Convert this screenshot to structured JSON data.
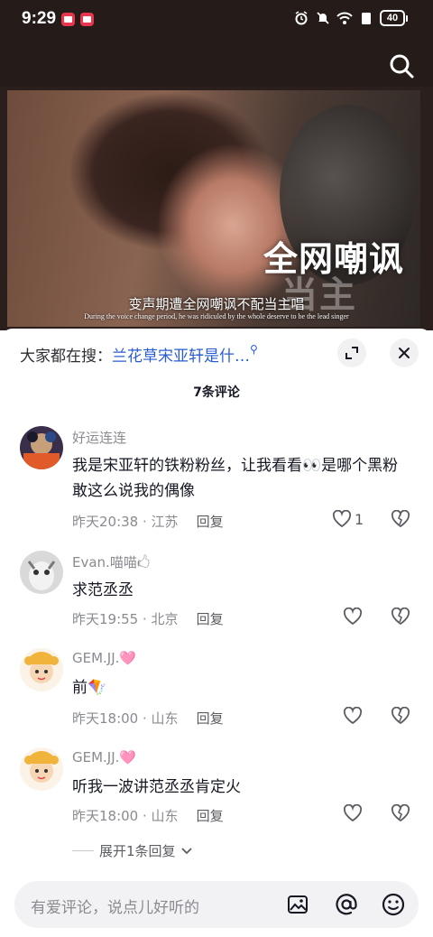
{
  "status_bar": {
    "time": "9:29",
    "battery": "40"
  },
  "video": {
    "overlay_title": "全网嘲讽",
    "overlay_ghost": "当主",
    "subtitle_cn": "变声期遭全网嘲讽不配当主唱",
    "subtitle_en": "During the voice change period, he was ridiculed by the whole deserve to be the lead singer"
  },
  "comments_panel": {
    "trending_prefix": "大家都在搜：",
    "trending_query": "兰花草宋亚轩是什…",
    "count_label": "7条评论",
    "comments": [
      {
        "username": "好运连连",
        "text": "我是宋亚轩的铁粉粉丝，让我看看👀是哪个黑粉敢这么说我的偶像",
        "time": "昨天20:38",
        "location": "江苏",
        "reply_label": "回复",
        "likes": "1"
      },
      {
        "username": "Evan.喵喵🖒",
        "text": "求范丞丞",
        "time": "昨天19:55",
        "location": "北京",
        "reply_label": "回复",
        "likes": ""
      },
      {
        "username": "GEM.JJ.🩷",
        "text": "前🪁",
        "time": "昨天18:00",
        "location": "山东",
        "reply_label": "回复",
        "likes": ""
      },
      {
        "username": "GEM.JJ.🩷",
        "text": "听我一波讲范丞丞肯定火",
        "time": "昨天18:00",
        "location": "山东",
        "reply_label": "回复",
        "likes": ""
      }
    ],
    "expand_label": "展开1条回复",
    "input_placeholder": "有爱评论，说点儿好听的"
  },
  "colors": {
    "link_blue": "#2a5cd1",
    "status_bg": "#251c1a",
    "meta_gray": "#8a8b91"
  }
}
